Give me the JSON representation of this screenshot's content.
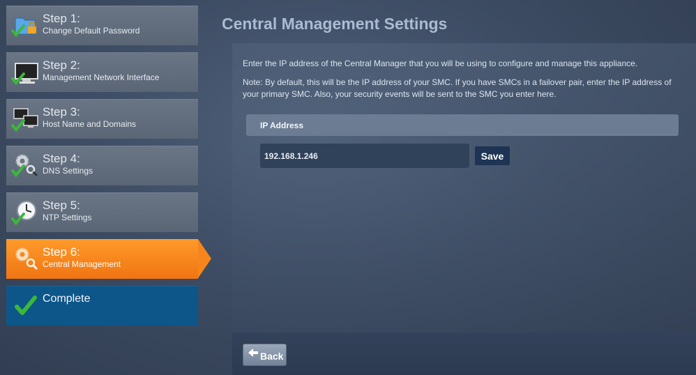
{
  "sidebar": {
    "steps": [
      {
        "number": "Step 1:",
        "label": "Change Default Password",
        "icon": "folder-lock-icon"
      },
      {
        "number": "Step 2:",
        "label": "Management Network Interface",
        "icon": "monitor-icon"
      },
      {
        "number": "Step 3:",
        "label": "Host Name and Domains",
        "icon": "network-computers-icon"
      },
      {
        "number": "Step 4:",
        "label": "DNS Settings",
        "icon": "gear-magnifier-icon"
      },
      {
        "number": "Step 5:",
        "label": "NTP Settings",
        "icon": "clock-icon"
      },
      {
        "number": "Step 6:",
        "label": "Central Management",
        "icon": "gear-magnifier-icon"
      }
    ],
    "complete": {
      "label": "Complete",
      "icon": "checkmark-icon"
    }
  },
  "main": {
    "title": "Central Management Settings",
    "intro": "Enter the IP address of the Central Manager that you will be using to configure and manage this appliance.",
    "note": "Note: By default, this will be the IP address of your SMC. If you have SMCs in a failover pair, enter the IP address of your primary SMC. Also, your security events will be sent to the SMC you enter here.",
    "ip_header": "IP Address",
    "ip_value": "192.168.1.246",
    "save_label": "Save",
    "back_label": "Back"
  },
  "colors": {
    "active_step": "#f5851c",
    "complete_step": "#0d5689",
    "check": "#3cb83a"
  }
}
